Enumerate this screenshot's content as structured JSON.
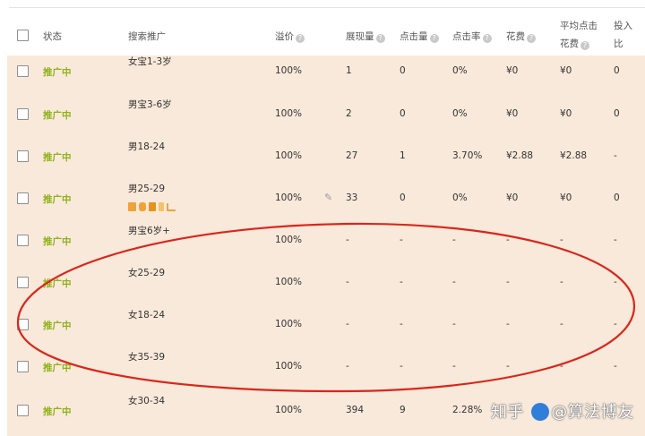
{
  "header": {
    "status": "状态",
    "keyword": "搜索推广",
    "premium": "溢价",
    "impressions": "展现量",
    "clicks": "点击量",
    "ctr": "点击率",
    "cost": "花费",
    "avg_cpc_line1": "平均点击",
    "avg_cpc_line2": "花费",
    "roi_line1": "投入",
    "roi_line2": "比"
  },
  "rows": [
    {
      "status": "推广中",
      "keyword": "女宝1-3岁",
      "premium": "100%",
      "impressions": "1",
      "clicks": "0",
      "ctr": "0%",
      "cost": "¥0",
      "avg_cpc": "¥0",
      "roi": "0"
    },
    {
      "status": "推广中",
      "keyword": "男宝3-6岁",
      "premium": "100%",
      "impressions": "2",
      "clicks": "0",
      "ctr": "0%",
      "cost": "¥0",
      "avg_cpc": "¥0",
      "roi": "0"
    },
    {
      "status": "推广中",
      "keyword": "男18-24",
      "premium": "100%",
      "impressions": "27",
      "clicks": "1",
      "ctr": "3.70%",
      "cost": "¥2.88",
      "avg_cpc": "¥2.88",
      "roi": "-"
    },
    {
      "status": "推广中",
      "keyword": "男25-29",
      "premium": "100%",
      "impressions": "33",
      "clicks": "0",
      "ctr": "0%",
      "cost": "¥0",
      "avg_cpc": "¥0",
      "roi": "0"
    },
    {
      "status": "推广中",
      "keyword": "男宝6岁+",
      "premium": "100%",
      "impressions": "-",
      "clicks": "-",
      "ctr": "-",
      "cost": "-",
      "avg_cpc": "-",
      "roi": "-"
    },
    {
      "status": "推广中",
      "keyword": "女25-29",
      "premium": "100%",
      "impressions": "-",
      "clicks": "-",
      "ctr": "-",
      "cost": "-",
      "avg_cpc": "-",
      "roi": "-"
    },
    {
      "status": "推广中",
      "keyword": "女18-24",
      "premium": "100%",
      "impressions": "-",
      "clicks": "-",
      "ctr": "-",
      "cost": "-",
      "avg_cpc": "-",
      "roi": "-"
    },
    {
      "status": "推广中",
      "keyword": "女35-39",
      "premium": "100%",
      "impressions": "-",
      "clicks": "-",
      "ctr": "-",
      "cost": "-",
      "avg_cpc": "-",
      "roi": "-"
    },
    {
      "status": "推广中",
      "keyword": "女30-34",
      "premium": "100%",
      "impressions": "394",
      "clicks": "9",
      "ctr": "2.28%",
      "cost": "",
      "avg_cpc": "",
      "roi": ""
    }
  ],
  "watermark": {
    "prefix": "知乎",
    "suffix": "@算法博友"
  },
  "colors": {
    "row_bg": "#f9e9da",
    "status_green": "#8fb21b",
    "annotation_red": "#d9261c",
    "tool_orange": "#f0a23a"
  }
}
